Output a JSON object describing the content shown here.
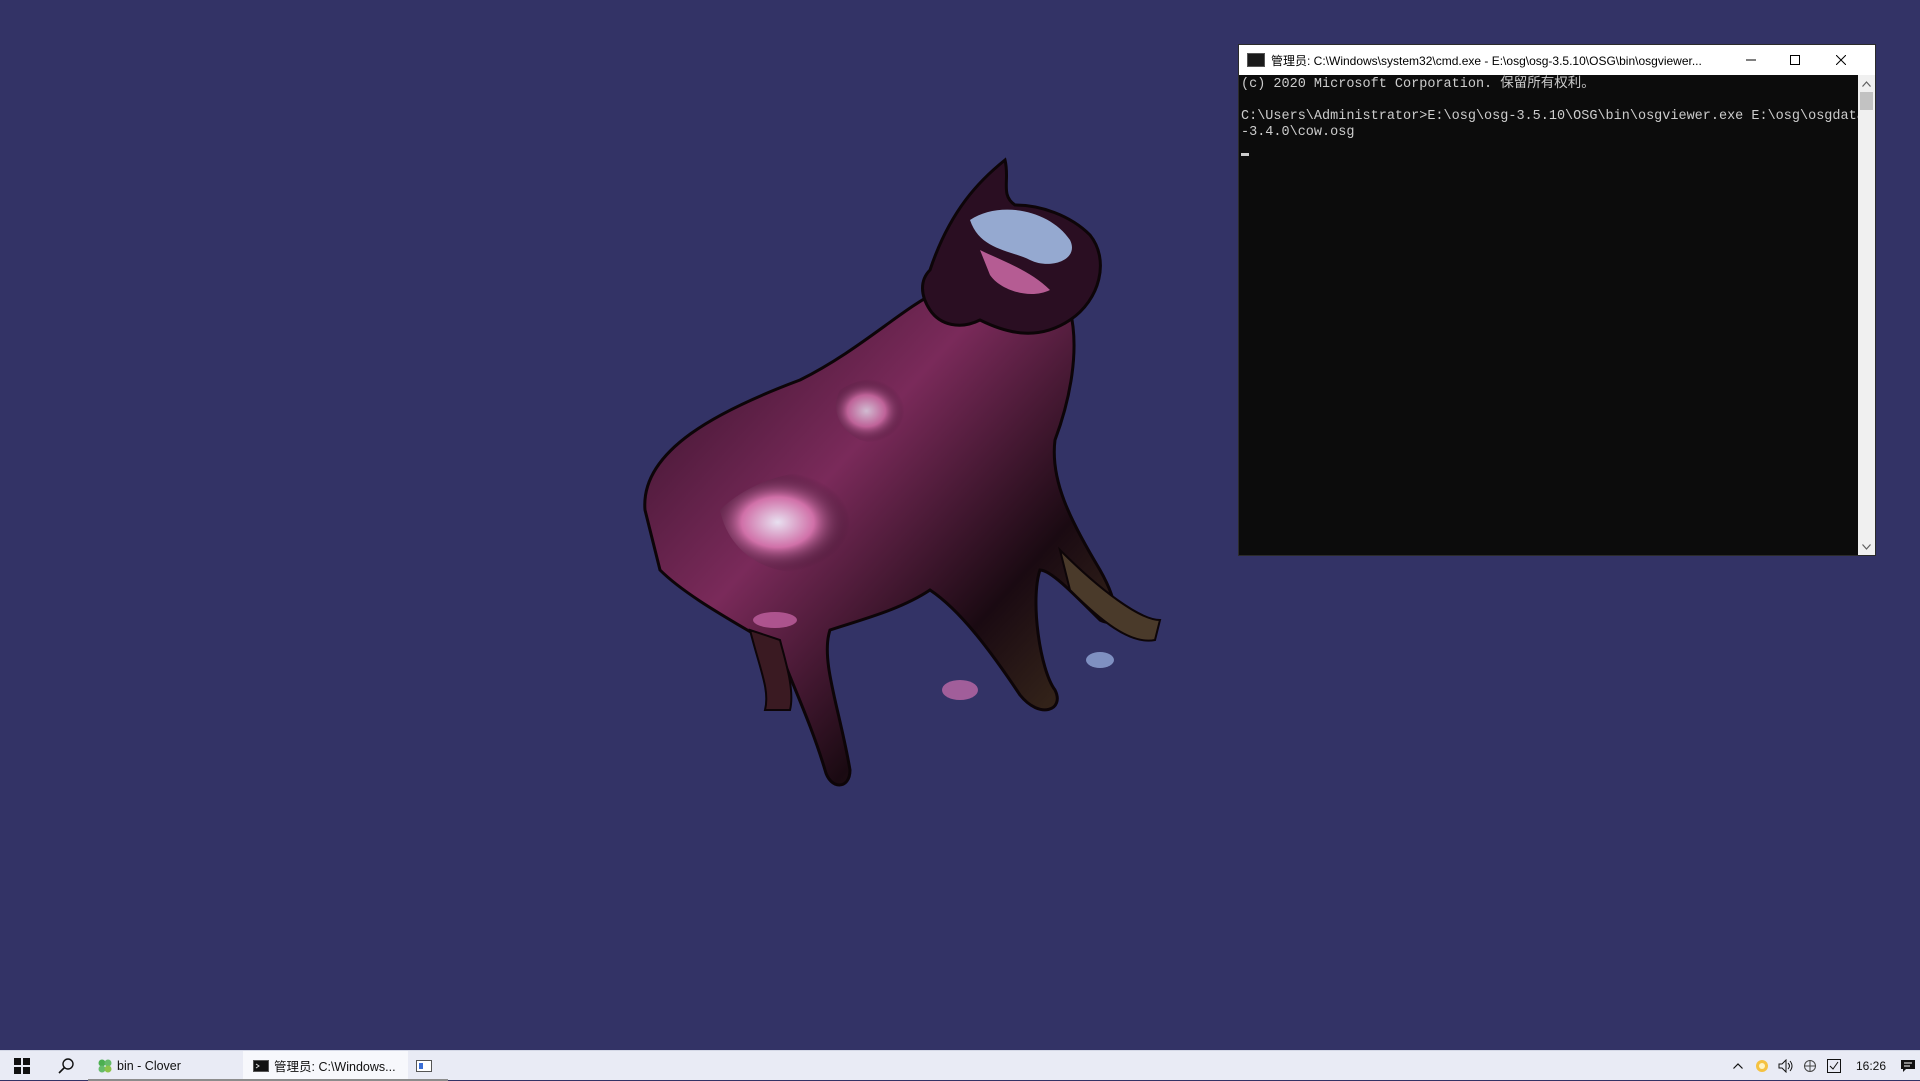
{
  "viewer": {
    "background_color": "#333366",
    "model": "cow"
  },
  "cmd": {
    "title": "管理员: C:\\Windows\\system32\\cmd.exe - E:\\osg\\osg-3.5.10\\OSG\\bin\\osgviewer...",
    "lines": [
      "(c) 2020 Microsoft Corporation. 保留所有权利。",
      "",
      "C:\\Users\\Administrator>E:\\osg\\osg-3.5.10\\OSG\\bin\\osgviewer.exe E:\\osg\\osgdata",
      "-3.4.0\\cow.osg"
    ]
  },
  "taskbar": {
    "apps": [
      {
        "label": "bin - Clover",
        "icon": "clover-icon"
      },
      {
        "label": "管理员: C:\\Windows...",
        "icon": "cmd-icon"
      },
      {
        "label": "",
        "icon": "osgviewer-icon"
      }
    ],
    "clock": "16:26"
  }
}
